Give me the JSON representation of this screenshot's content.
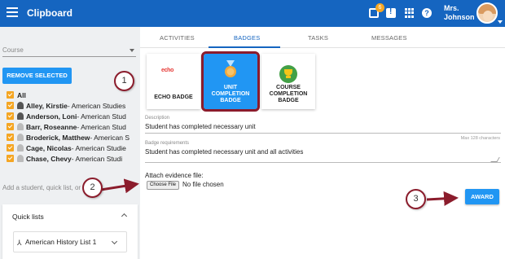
{
  "app": {
    "title": "Clipboard"
  },
  "header": {
    "notification_count": "6",
    "user_name_line1": "Mrs.",
    "user_name_line2": "Johnson"
  },
  "left": {
    "course_placeholder": "Course",
    "remove_button": "REMOVE SELECTED",
    "all_label": "All",
    "students": [
      {
        "name": "Alley, Kirstie",
        "course": " - American Studies"
      },
      {
        "name": "Anderson, Loni",
        "course": " - American Stud"
      },
      {
        "name": "Barr, Roseanne",
        "course": " - American Stud"
      },
      {
        "name": "Broderick, Matthew",
        "course": " - American S"
      },
      {
        "name": "Cage, Nicolas",
        "course": " - American Studie"
      },
      {
        "name": "Chase, Chevy",
        "course": " - American Studi"
      }
    ],
    "add_placeholder": "Add a student, quick list, or g",
    "quick_lists_title": "Quick lists",
    "quick_list_item": "American History List 1"
  },
  "tabs": [
    {
      "label": "ACTIVITIES"
    },
    {
      "label": "BADGES"
    },
    {
      "label": "TASKS"
    },
    {
      "label": "MESSAGES"
    }
  ],
  "badges": [
    {
      "label_line1": "ECHO BADGE",
      "label_line2": "",
      "label_line3": ""
    },
    {
      "label_line1": "UNIT",
      "label_line2": "COMPLETION",
      "label_line3": "BADGE"
    },
    {
      "label_line1": "COURSE",
      "label_line2": "COMPLETION",
      "label_line3": "BADGE"
    }
  ],
  "echo_logo": {
    "part1": "echo",
    "part2": ""
  },
  "form": {
    "description_label": "Description",
    "description_value": "Student has completed necessary unit",
    "max_chars": "Max 128 characters",
    "requirements_label": "Badge requirements",
    "requirements_value": "Student has completed necessary unit and all activities",
    "attach_label": "Attach evidence file:",
    "choose_file": "Choose File",
    "no_file": "No file chosen",
    "award_button": "AWARD"
  },
  "callouts": [
    "1",
    "2",
    "3"
  ],
  "colors": {
    "header": "#1565c0",
    "primary_button": "#2196f3",
    "checkbox": "#f5a623",
    "callout_accent": "#8b1c2c"
  }
}
